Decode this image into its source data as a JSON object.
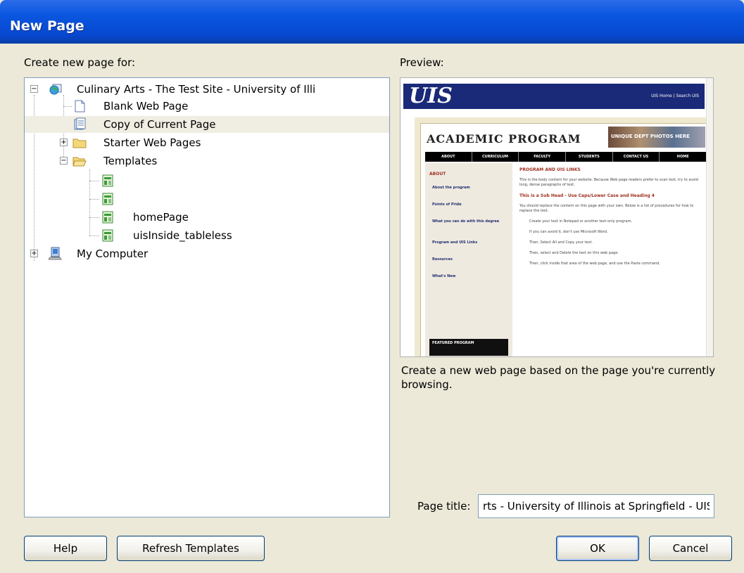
{
  "window": {
    "title": "New Page"
  },
  "left": {
    "label": "Create new page for:"
  },
  "tree": {
    "root": "Culinary Arts - The Test Site - University of Illi",
    "blank": "Blank Web Page",
    "copy": "Copy of Current Page",
    "starter": "Starter Web Pages",
    "templates": "Templates",
    "template_items": [
      "",
      "",
      "homePage",
      "uisInside_tableless"
    ],
    "computer": "My Computer"
  },
  "preview": {
    "label": "Preview:",
    "thumb": {
      "logo": "UIS",
      "toplinks": "UIS Home  |  Search UIS",
      "heading": "ACADEMIC PROGRAM",
      "photo_text": "UNIQUE DEPT PHOTOS HERE",
      "nav": [
        "ABOUT",
        "CURRICULUM",
        "FACULTY",
        "STUDENTS",
        "CONTACT US",
        "HOME"
      ],
      "side_heading": "ABOUT",
      "side_items": [
        "About the program",
        "Points of Pride",
        "What you can do with this degree",
        "Program and UIS Links",
        "Resources",
        "What's New"
      ],
      "featured": "FEATURED PROGRAM",
      "main_heading": "PROGRAM AND UIS LINKS",
      "main_text": "This is the body content for your website. Because Web page readers prefer to scan text, try to avoid long, dense paragraphs of text.",
      "sub_heading": "This is a Sub Head - Use Caps/Lower Case and Heading 4",
      "main_text2": "You should replace the content on this page with your own. Below is a list of procedures for how to replace the text.",
      "bullets": [
        "Create your text in Notepad or another text-only program.",
        "If you can avoid it, don't use Microsoft Word.",
        "Then, Select All and Copy your text.",
        "Then, select and Delete the text on this web page.",
        "Then, click inside that area of the web page, and use the Paste command."
      ]
    },
    "description": "Create a new web page based on the page you're currently browsing."
  },
  "page_title": {
    "label": "Page title:",
    "value": "rts - University of Illinois at Springfield - UIS"
  },
  "buttons": {
    "help": "Help",
    "refresh": "Refresh Templates",
    "ok": "OK",
    "cancel": "Cancel"
  }
}
